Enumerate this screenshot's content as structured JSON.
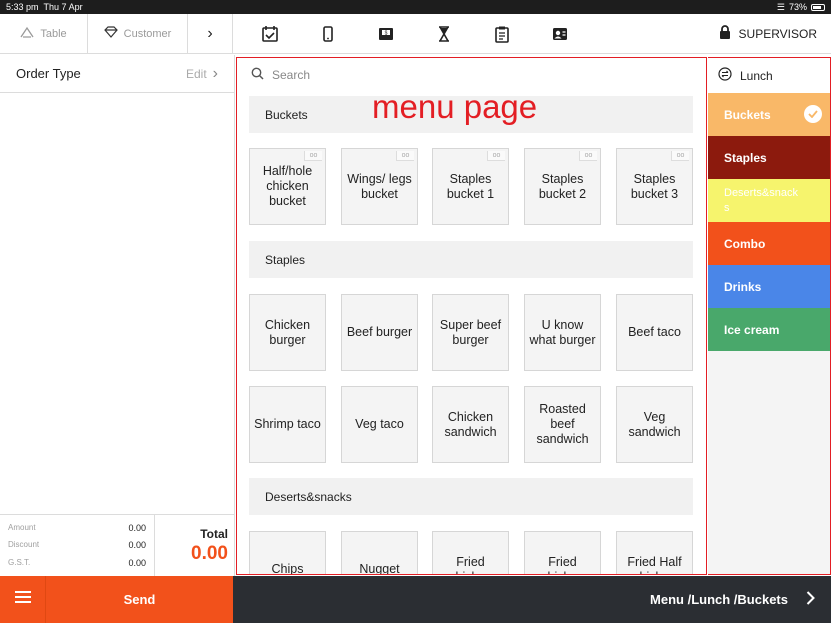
{
  "status_bar": {
    "time": "5:33 pm",
    "date": "Thu 7 Apr",
    "battery": "73%"
  },
  "topbar": {
    "table_label": "Table",
    "customer_label": "Customer",
    "tools": [
      "calendar-check-icon",
      "tablet-icon",
      "cash-drawer-icon",
      "hourglass-icon",
      "clipboard-icon",
      "user-card-icon"
    ],
    "supervisor_label": "SUPERVISOR"
  },
  "order_panel": {
    "order_type_label": "Order Type",
    "edit_label": "Edit",
    "amount_label": "Amount",
    "amount_value": "0.00",
    "discount_label": "Discount",
    "discount_value": "0.00",
    "gst_label": "G.S.T.",
    "gst_value": "0.00",
    "total_label": "Total",
    "total_value": "0.00"
  },
  "menu": {
    "search_placeholder": "Search",
    "annotation": "menu page",
    "sections": [
      {
        "title": "Buckets",
        "items": [
          "Half/hole chicken bucket",
          "Wings/ legs bucket",
          "Staples bucket 1",
          "Staples bucket 2",
          "Staples bucket 3"
        ]
      },
      {
        "title": "Staples",
        "items": [
          "Chicken burger",
          "Beef burger",
          "Super beef burger",
          "U know what burger",
          "Beef taco",
          "Shrimp taco",
          "Veg taco",
          "Chicken sandwich",
          "Roasted beef sandwich",
          "Veg sandwich"
        ]
      },
      {
        "title": "Deserts&snacks",
        "items": [
          "Chips",
          "Nugget",
          "Fried chicken",
          "Fried chicken",
          "Fried Half chicken"
        ]
      }
    ],
    "link_badge": "oo"
  },
  "categories": {
    "menu_name": "Lunch",
    "items": [
      {
        "label": "Buckets",
        "color": "#f9b868",
        "selected": true
      },
      {
        "label": "Staples",
        "color": "#8c1a0d",
        "selected": false
      },
      {
        "label": "Deserts&snacks",
        "color": "#f6f46d",
        "selected": false
      },
      {
        "label": "Combo",
        "color": "#f2511b",
        "selected": false
      },
      {
        "label": "Drinks",
        "color": "#4a86e8",
        "selected": false
      },
      {
        "label": "Ice cream",
        "color": "#49a86b",
        "selected": false
      }
    ]
  },
  "bottom_bar": {
    "send_label": "Send",
    "breadcrumb": "Menu /Lunch /Buckets"
  }
}
